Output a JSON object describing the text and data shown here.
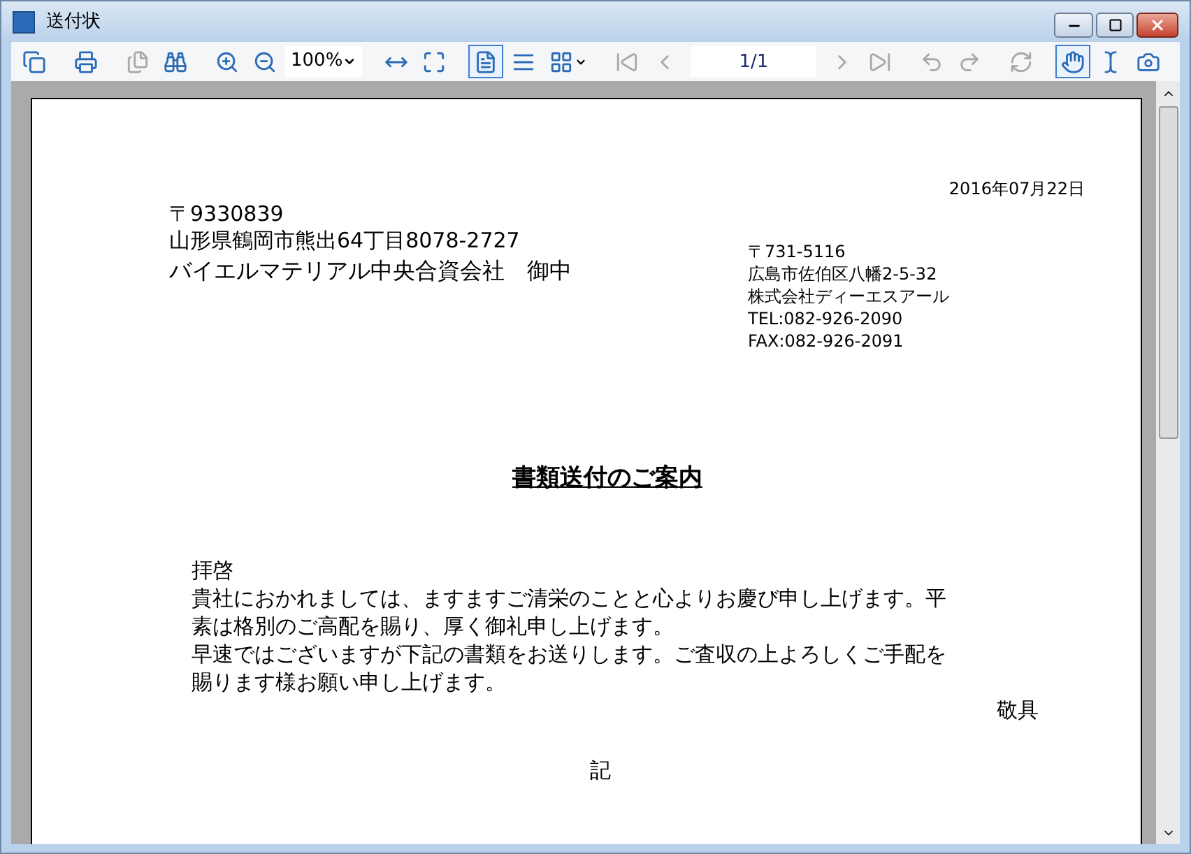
{
  "window": {
    "title": "送付状"
  },
  "toolbar": [
    {
      "kind": "button",
      "selected": false,
      "disabled": false
    },
    {
      "kind": "separator"
    },
    {
      "kind": "button",
      "selected": false,
      "disabled": false
    },
    {
      "kind": "separator"
    },
    {
      "kind": "button",
      "selected": false,
      "disabled": true
    },
    {
      "kind": "button",
      "selected": false,
      "disabled": false
    },
    {
      "kind": "separator"
    },
    {
      "kind": "button",
      "selected": false,
      "disabled": false
    },
    {
      "kind": "button",
      "selected": false,
      "disabled": false
    },
    {
      "kind": "combo",
      "value": "100%"
    },
    {
      "kind": "separator"
    },
    {
      "kind": "button",
      "selected": false,
      "disabled": false
    },
    {
      "kind": "button",
      "selected": false,
      "disabled": false
    },
    {
      "kind": "separator"
    },
    {
      "kind": "button",
      "selected": true,
      "disabled": false
    },
    {
      "kind": "button",
      "selected": false,
      "disabled": false
    },
    {
      "kind": "dropdown",
      "selected": false,
      "disabled": false
    },
    {
      "kind": "separator"
    },
    {
      "kind": "button",
      "selected": false,
      "disabled": true
    },
    {
      "kind": "button",
      "selected": false,
      "disabled": true
    },
    {
      "kind": "field",
      "value": "1/1"
    },
    {
      "kind": "button",
      "selected": false,
      "disabled": true
    },
    {
      "kind": "button",
      "selected": false,
      "disabled": true
    },
    {
      "kind": "separator"
    },
    {
      "kind": "button",
      "selected": false,
      "disabled": true
    },
    {
      "kind": "button",
      "selected": false,
      "disabled": true
    },
    {
      "kind": "separator"
    },
    {
      "kind": "button",
      "selected": false,
      "disabled": true
    },
    {
      "kind": "separator"
    },
    {
      "kind": "button",
      "selected": true,
      "disabled": false
    },
    {
      "kind": "button",
      "selected": false,
      "disabled": false
    },
    {
      "kind": "button",
      "selected": false,
      "disabled": false
    },
    {
      "kind": "separator"
    }
  ],
  "document": {
    "date": "2016年07月22日",
    "recipient": {
      "postal_code": "〒9330839",
      "address": "山形県鶴岡市熊出64丁目8078-2727",
      "name": "バイエルマテリアル中央合資会社　御中"
    },
    "sender": [
      "〒731-5116",
      "広島市佐伯区八幡2-5-32",
      "株式会社ディーエスアール",
      "TEL:082-926-2090",
      "FAX:082-926-2091"
    ],
    "title": "書類送付のご案内",
    "salutation": "拝啓",
    "body_lines": [
      "貴社におかれましては、ますますご清栄のことと心よりお慶び申し上げます。平",
      "素は格別のご高配を賜り、厚く御礼申し上げます。",
      "早速ではございますが下記の書類をお送りします。ご査収の上よろしくご手配を",
      "賜ります様お願い申し上げます。"
    ],
    "closing": "敬具",
    "note_heading": "記"
  }
}
